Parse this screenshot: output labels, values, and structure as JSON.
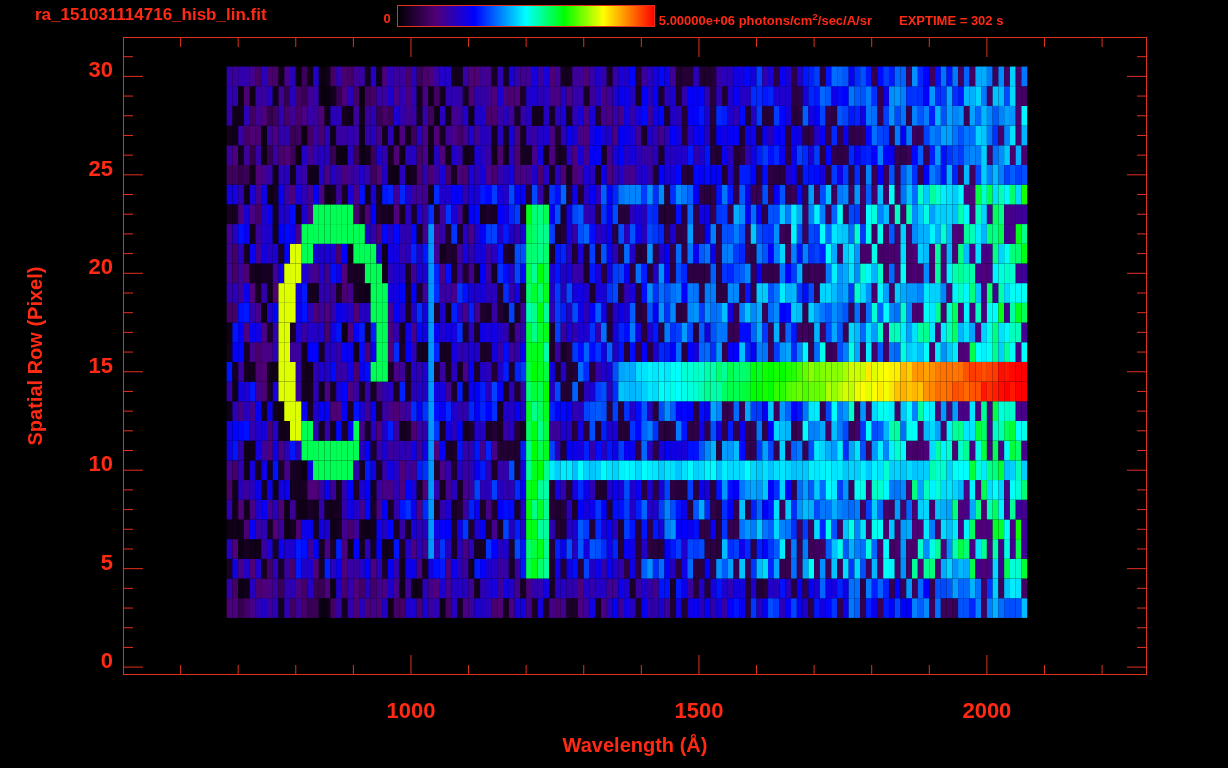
{
  "title": "ra_151031114716_hisb_lin.fit",
  "colorbar": {
    "min_label": "0",
    "max_label": "5.00000e+06 photons/cm$^{2}$/sec/A/sr"
  },
  "exptime": "EXPTIME = 302 s",
  "plot": {
    "xlabel": "Wavelength (Å)",
    "ylabel": "Spatial Row (Pixel)",
    "xticks": [
      "1000",
      "1500",
      "2000"
    ],
    "yticks": [
      "30",
      "25",
      "20",
      "15",
      "10",
      "5",
      "0"
    ]
  }
}
